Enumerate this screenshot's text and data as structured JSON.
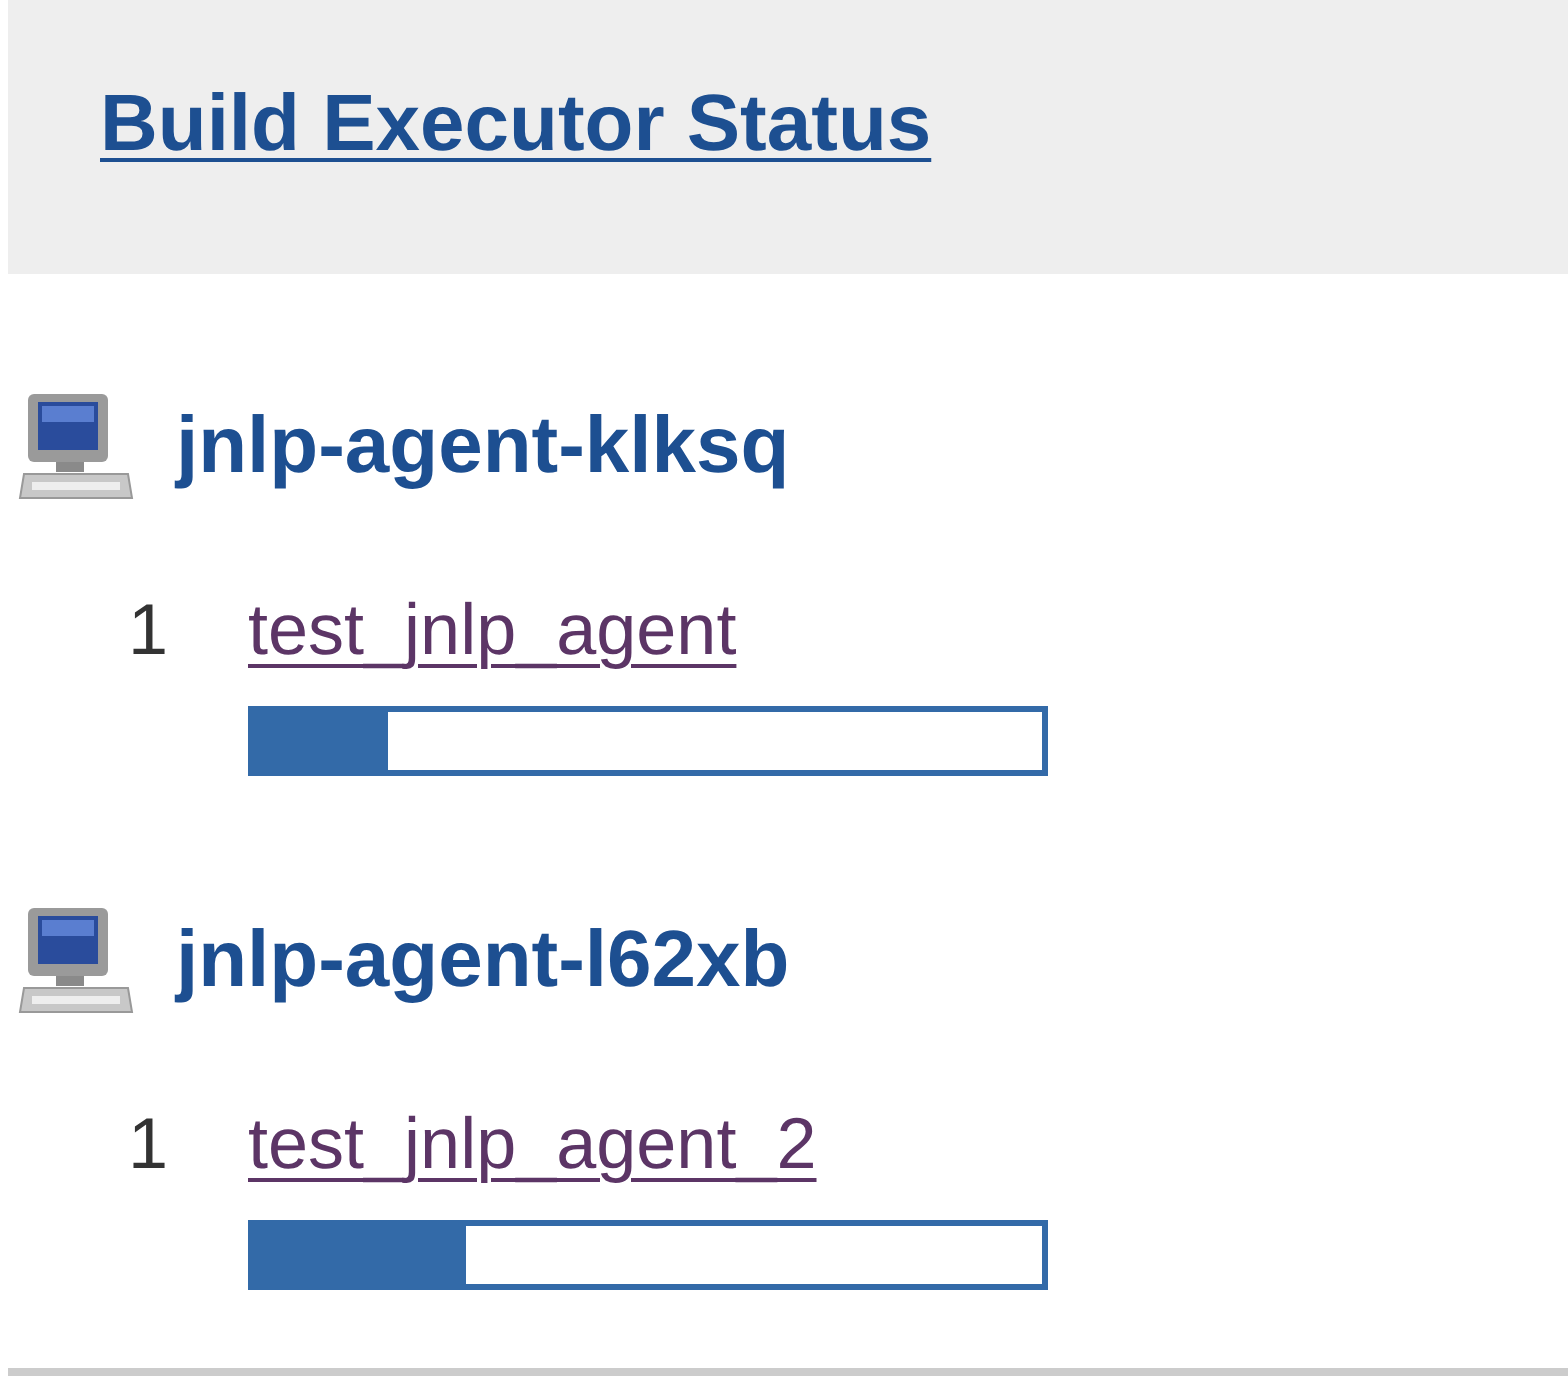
{
  "panel": {
    "title": "Build Executor Status"
  },
  "agents": [
    {
      "name": "jnlp-agent-klksq",
      "executors": [
        {
          "number": "1",
          "job": "test_jnlp_agent",
          "level": 0.17
        }
      ]
    },
    {
      "name": "jnlp-agent-l62xb",
      "executors": [
        {
          "number": "1",
          "job": "test_jnlp_agent_2",
          "level": 0.27
        }
      ]
    }
  ]
}
